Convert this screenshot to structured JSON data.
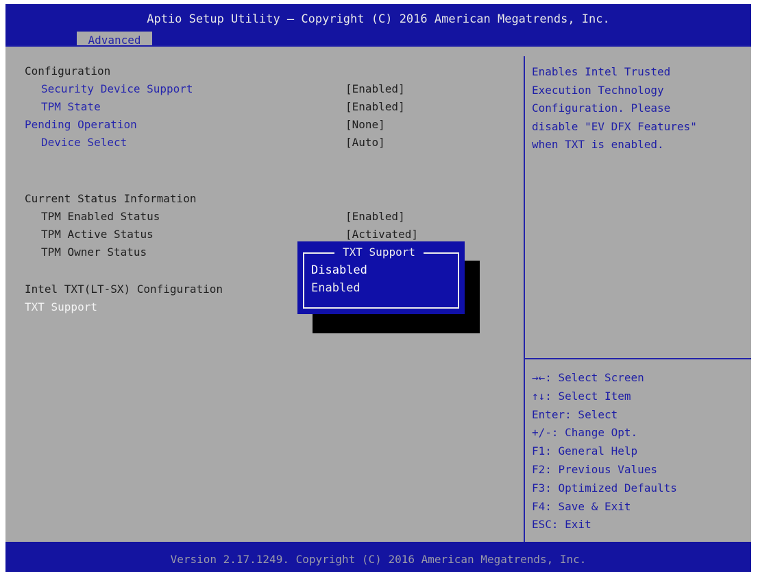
{
  "window": {
    "title": "Aptio Setup Utility – Copyright (C) 2016 American Megatrends, Inc.",
    "active_tab": "Advanced"
  },
  "settings": {
    "configuration_heading": "Configuration",
    "items": [
      {
        "label": "Security Device Support",
        "value": "[Enabled]"
      },
      {
        "label": "TPM State",
        "value": "[Enabled]"
      },
      {
        "label": "Pending Operation",
        "value": "[None]"
      },
      {
        "label": "Device Select",
        "value": "[Auto]"
      }
    ],
    "status_heading": "Current Status Information",
    "status_items": [
      {
        "label": "TPM Enabled Status",
        "value": "[Enabled]"
      },
      {
        "label": "TPM Active Status",
        "value": "[Activated]"
      },
      {
        "label": "TPM Owner Status",
        "value": ""
      }
    ],
    "txt_heading": "Intel TXT(LT-SX) Configuration",
    "txt_support_label": "TXT Support"
  },
  "popup": {
    "title": "TXT Support",
    "options": [
      "Disabled",
      "Enabled"
    ],
    "selected": "Disabled"
  },
  "help": {
    "lines": [
      "Enables Intel Trusted",
      "Execution Technology",
      "Configuration. Please",
      "disable \"EV DFX Features\"",
      "when TXT is enabled."
    ]
  },
  "keys": [
    "→←: Select Screen",
    "↑↓: Select Item",
    "Enter: Select",
    "+/-: Change Opt.",
    "F1: General Help",
    "F2: Previous Values",
    "F3: Optimized Defaults",
    "F4: Save & Exit",
    "ESC: Exit"
  ],
  "footer": {
    "text": "Version 2.17.1249. Copyright (C) 2016 American Megatrends, Inc."
  },
  "colors": {
    "bios_blue": "#1414a0",
    "panel_gray": "#a9a9a9",
    "text_blue": "#2626ad",
    "highlight_white": "#f4f4f4"
  }
}
